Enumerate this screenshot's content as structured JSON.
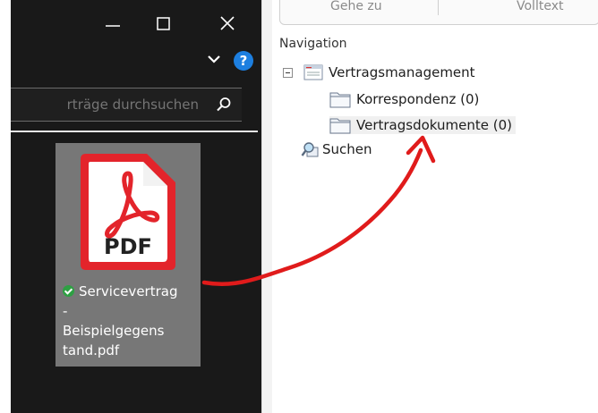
{
  "explorer": {
    "search_placeholder": "rträge durchsuchen",
    "help_label": "?",
    "file": {
      "type_label": "PDF",
      "name_lines": [
        "Servicevertrag",
        "-",
        "Beispielgegens",
        "tand.pdf"
      ],
      "status": "synced",
      "icon_name": "pdf-file-icon"
    }
  },
  "nav": {
    "tabs": [
      "Gehe zu",
      "Volltext"
    ],
    "title": "Navigation",
    "tree": {
      "root": {
        "label": "Vertragsmanagement",
        "expanded": true
      },
      "children": [
        {
          "label": "Korrespondenz (0)"
        },
        {
          "label": "Vertragsdokumente (0)"
        }
      ],
      "search": {
        "label": "Suchen"
      }
    }
  },
  "colors": {
    "explorer_bg": "#191919",
    "accent_blue": "#1d7fe0",
    "pdf_red": "#e3242b",
    "arrow_red": "#e01b1b",
    "status_green": "#2ea043"
  }
}
